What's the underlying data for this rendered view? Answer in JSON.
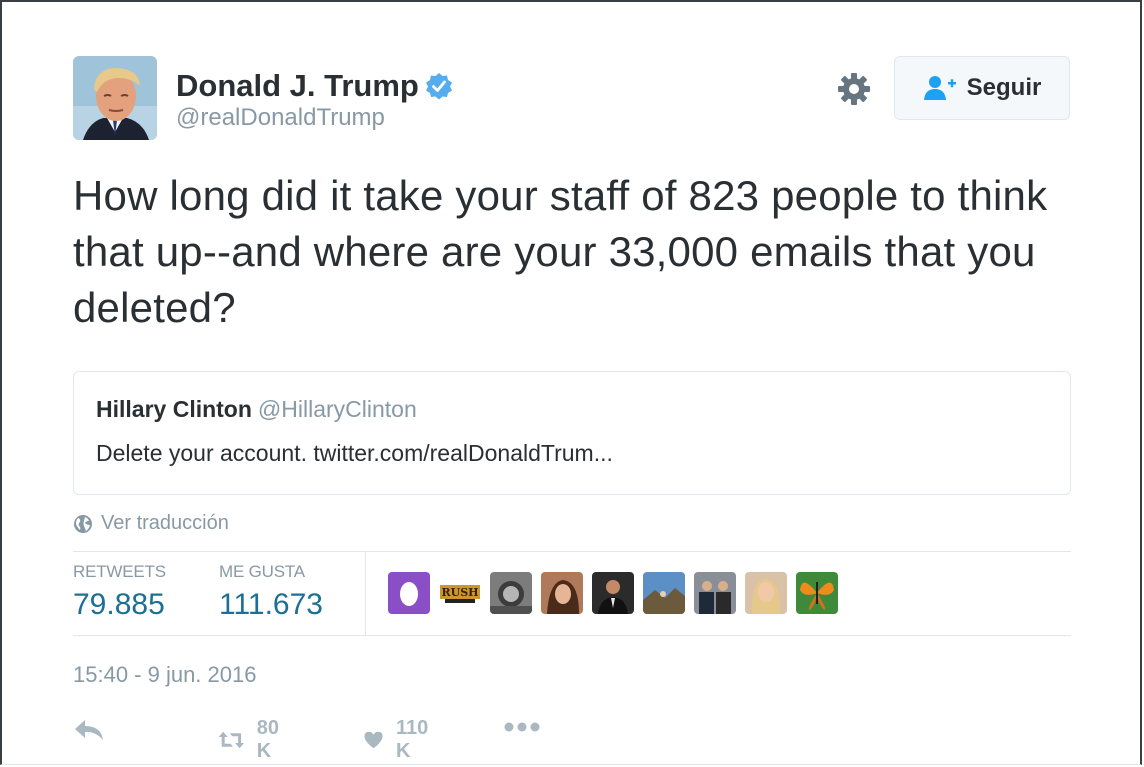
{
  "author": {
    "name": "Donald J. Trump",
    "handle": "@realDonaldTrump",
    "verified": true
  },
  "header": {
    "follow_label": "Seguir"
  },
  "tweet": {
    "text": "How long did it take your staff of 823 people to think that up--and where are your 33,000 emails that you deleted?"
  },
  "quoted_tweet": {
    "name": "Hillary Clinton",
    "handle": "@HillaryClinton",
    "text": "Delete your account. twitter.com/realDonaldTrum..."
  },
  "translate_label": "Ver traducción",
  "stats": {
    "retweets_label": "RETWEETS",
    "retweets_value": "79.885",
    "likes_label": "ME GUSTA",
    "likes_value": "111.673"
  },
  "likers": [
    {
      "name": "egg-avatar"
    },
    {
      "name": "rush-logo-avatar"
    },
    {
      "name": "grayscale-portrait-avatar"
    },
    {
      "name": "woman-selfie-avatar"
    },
    {
      "name": "man-suit-avatar"
    },
    {
      "name": "landscape-avatar"
    },
    {
      "name": "group-photo-avatar"
    },
    {
      "name": "blonde-woman-avatar"
    },
    {
      "name": "butterfly-avatar"
    }
  ],
  "timestamp": "15:40 - 9 jun. 2016",
  "actions": {
    "retweet_count": "80 K",
    "like_count": "110 K"
  },
  "colors": {
    "accent_blue": "#1c6f95",
    "verified_blue": "#55acee",
    "muted_gray": "#8899a6"
  }
}
